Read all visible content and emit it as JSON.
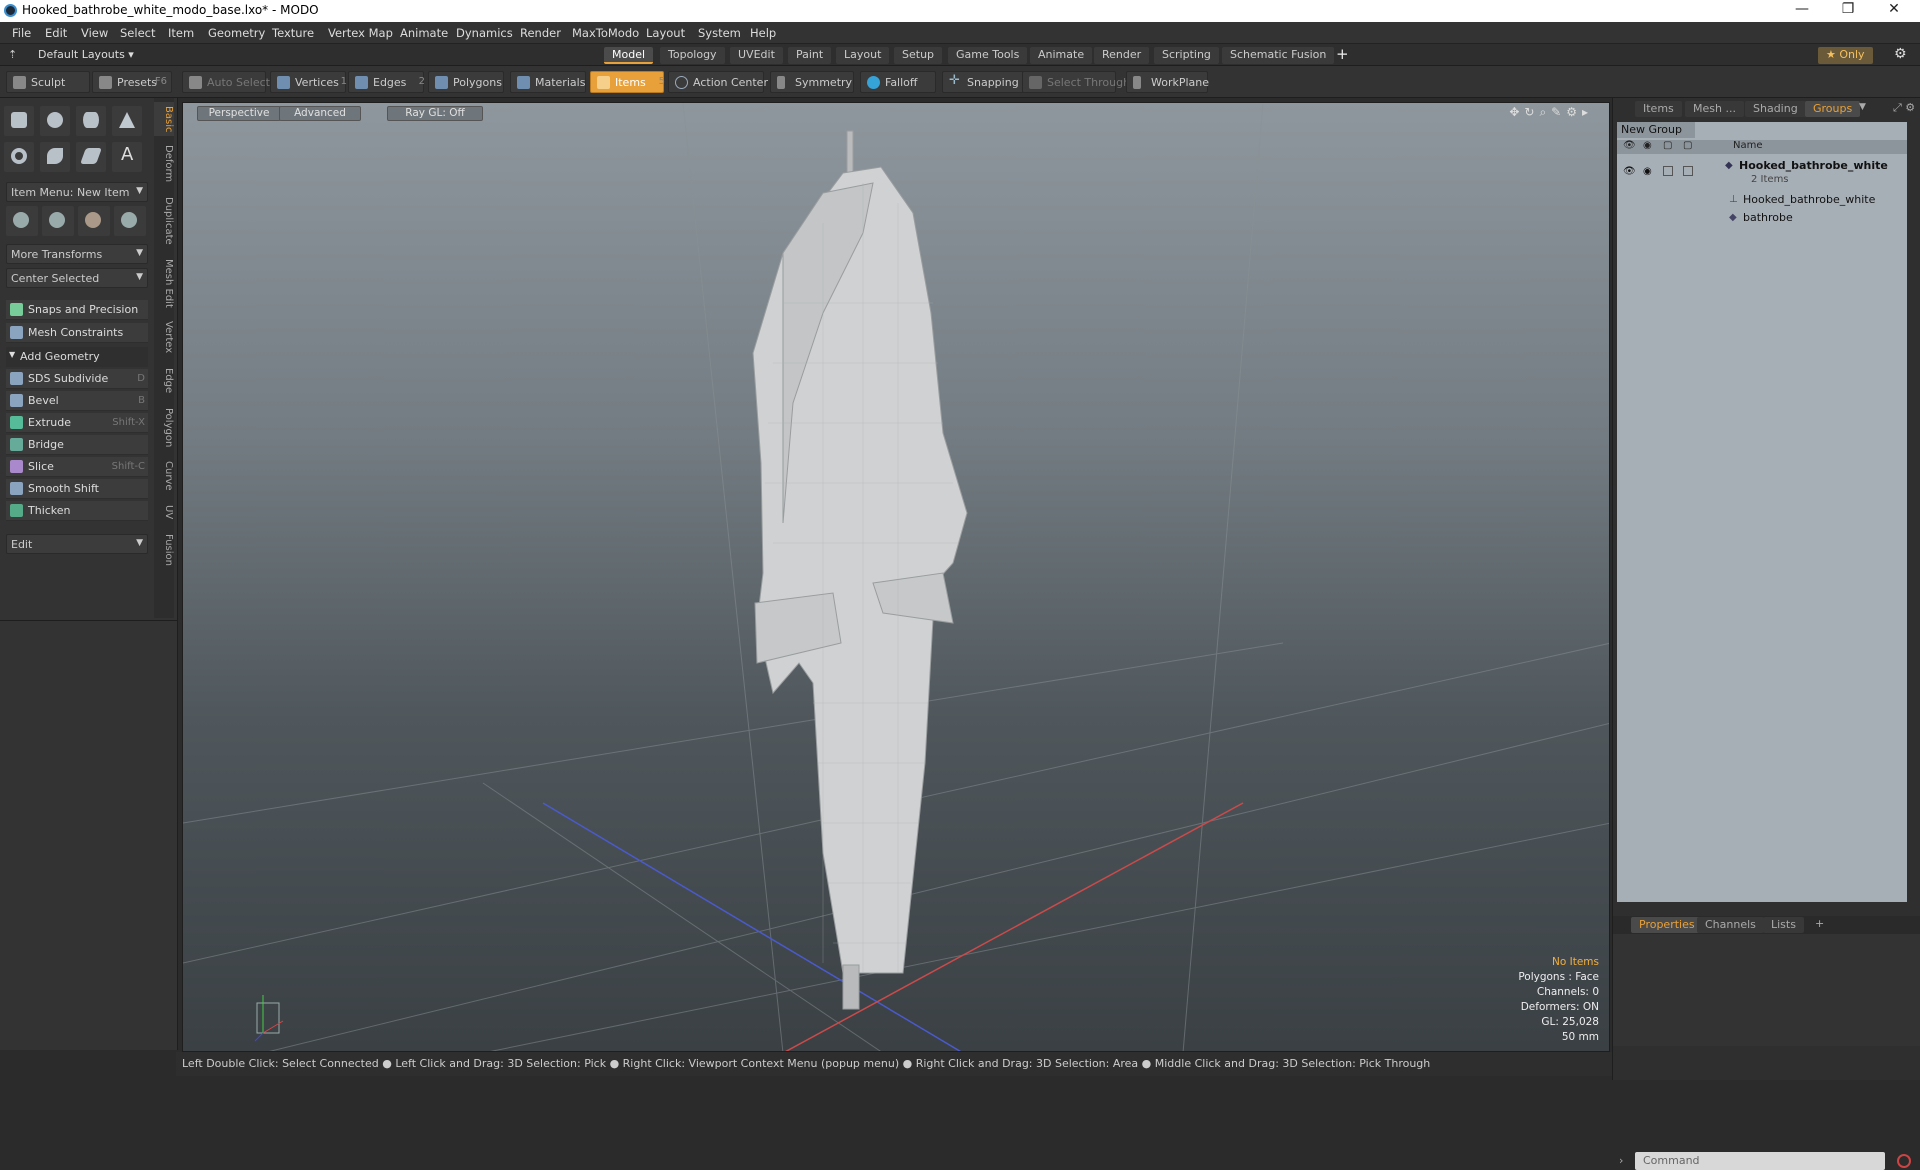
{
  "window": {
    "title": "Hooked_bathrobe_white_modo_base.lxo* - MODO",
    "controls": [
      "—",
      "❐",
      "✕"
    ]
  },
  "menu": [
    "File",
    "Edit",
    "View",
    "Select",
    "Item",
    "Geometry",
    "Texture",
    "Vertex Map",
    "Animate",
    "Dynamics",
    "Render",
    "MaxToModo",
    "Layout",
    "System",
    "Help"
  ],
  "layout_bar": {
    "default_layouts": "Default Layouts ▾",
    "tabs": [
      "Model",
      "Topology",
      "UVEdit",
      "Paint",
      "Layout",
      "Setup",
      "Game Tools",
      "Animate",
      "Render",
      "Scripting",
      "Schematic Fusion"
    ],
    "active_tab": "Model",
    "plus": "+",
    "only": "★  Only",
    "gear": "⚙"
  },
  "toolbar": {
    "sculpt": "Sculpt",
    "presets": "Presets",
    "presets_key": "F6",
    "auto_select": "Auto Select",
    "vertices": "Vertices",
    "vertices_num": "1",
    "edges": "Edges",
    "edges_num": "2",
    "polygons": "Polygons",
    "materials": "Materials",
    "items": "Items",
    "items_num": "5",
    "action_center": "Action Center",
    "symmetry": "Symmetry",
    "falloff": "Falloff",
    "snapping": "Snapping",
    "select_through": "Select Through",
    "workplane": "WorkPlane"
  },
  "left_panel": {
    "vertical_tabs": [
      "Basic",
      "Deform",
      "Duplicate",
      "Mesh Edit",
      "Vertex",
      "Edge",
      "Polygon",
      "Curve",
      "UV",
      "Fusion"
    ],
    "item_menu": "Item Menu: New Item",
    "more_transforms": "More Transforms",
    "center_selected": "Center Selected",
    "snaps": "Snaps and Precision",
    "mesh_constraints": "Mesh Constraints",
    "add_geometry": "Add Geometry",
    "tools": [
      {
        "label": "SDS Subdivide",
        "shortcut": "D"
      },
      {
        "label": "Bevel",
        "shortcut": "B"
      },
      {
        "label": "Extrude",
        "shortcut": "Shift-X"
      },
      {
        "label": "Bridge",
        "shortcut": ""
      },
      {
        "label": "Slice",
        "shortcut": "Shift-C"
      },
      {
        "label": "Smooth Shift",
        "shortcut": ""
      },
      {
        "label": "Thicken",
        "shortcut": ""
      }
    ],
    "edit": "Edit"
  },
  "viewport": {
    "perspective": "Perspective",
    "advanced": "Advanced",
    "raygl": "Ray GL: Off",
    "info": {
      "no_items": "No Items",
      "polygons": "Polygons : Face",
      "channels": "Channels: 0",
      "deformers": "Deformers: ON",
      "gl": "GL: 25,028",
      "scale": "50 mm"
    }
  },
  "status_bar": "Left Double Click: Select Connected ● Left Click and Drag: 3D Selection: Pick ● Right Click: Viewport Context Menu (popup menu) ● Right Click and Drag: 3D Selection: Area ● Middle Click and Drag: 3D Selection: Pick Through",
  "right_panel": {
    "tabs": [
      "Items",
      "Mesh ...",
      "Shading",
      "Groups"
    ],
    "active_tab": "Groups",
    "new_group": "New Group",
    "name_header": "Name",
    "group_name": "Hooked_bathrobe_white",
    "group_count": "2 Items",
    "children": [
      "Hooked_bathrobe_white",
      "bathrobe"
    ],
    "bottom_tabs": [
      "Properties",
      "Channels",
      "Lists"
    ],
    "bottom_active": "Properties",
    "bottom_plus": "+",
    "command_placeholder": "Command"
  }
}
